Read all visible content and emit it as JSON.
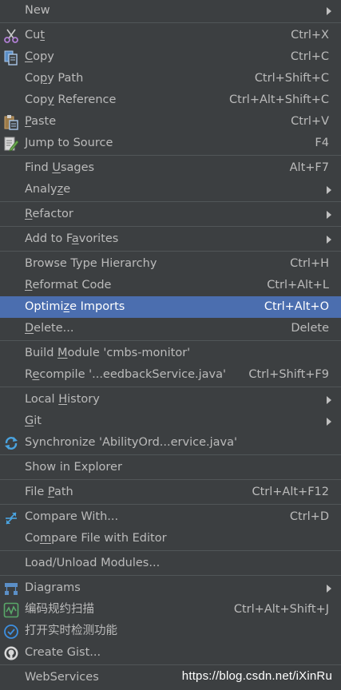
{
  "menu": {
    "new": {
      "label": "New"
    },
    "cut": {
      "pre": "Cu",
      "mn": "t",
      "post": "",
      "shortcut": "Ctrl+X"
    },
    "copy": {
      "pre": "",
      "mn": "C",
      "post": "opy",
      "shortcut": "Ctrl+C"
    },
    "copy_path": {
      "pre": "Co",
      "mn": "p",
      "post": "y Path",
      "shortcut": "Ctrl+Shift+C"
    },
    "copy_reference": {
      "pre": "Cop",
      "mn": "y",
      "post": " Reference",
      "shortcut": "Ctrl+Alt+Shift+C"
    },
    "paste": {
      "pre": "",
      "mn": "P",
      "post": "aste",
      "shortcut": "Ctrl+V"
    },
    "jump_to_source": {
      "label": "Jump to Source",
      "shortcut": "F4"
    },
    "find_usages": {
      "pre": "Find ",
      "mn": "U",
      "post": "sages",
      "shortcut": "Alt+F7"
    },
    "analyze": {
      "pre": "Analy",
      "mn": "z",
      "post": "e"
    },
    "refactor": {
      "pre": "",
      "mn": "R",
      "post": "efactor"
    },
    "add_to_favorites": {
      "pre": "Add to F",
      "mn": "a",
      "post": "vorites"
    },
    "browse_type_hierarchy": {
      "label": "Browse Type Hierarchy",
      "shortcut": "Ctrl+H"
    },
    "reformat_code": {
      "pre": "",
      "mn": "R",
      "post": "eformat Code",
      "shortcut": "Ctrl+Alt+L"
    },
    "optimize_imports": {
      "pre": "Optimi",
      "mn": "z",
      "post": "e Imports",
      "shortcut": "Ctrl+Alt+O"
    },
    "delete": {
      "pre": "",
      "mn": "D",
      "post": "elete...",
      "shortcut": "Delete"
    },
    "build_module": {
      "pre": "Build ",
      "mn": "M",
      "post": "odule 'cmbs-monitor'"
    },
    "recompile": {
      "pre": "R",
      "mn": "e",
      "post": "compile '...eedbackService.java'",
      "shortcut": "Ctrl+Shift+F9"
    },
    "local_history": {
      "pre": "Local ",
      "mn": "H",
      "post": "istory"
    },
    "git": {
      "pre": "",
      "mn": "G",
      "post": "it"
    },
    "synchronize": {
      "label": "Synchronize 'AbilityOrd...ervice.java'"
    },
    "show_in_explorer": {
      "label": "Show in Explorer"
    },
    "file_path": {
      "pre": "File ",
      "mn": "P",
      "post": "ath",
      "shortcut": "Ctrl+Alt+F12"
    },
    "compare_with": {
      "label": "Compare With...",
      "shortcut": "Ctrl+D"
    },
    "compare_file_with_editor": {
      "pre": "Co",
      "mn": "m",
      "post": "pare File with Editor"
    },
    "load_unload_modules": {
      "label": "Load/Unload Modules..."
    },
    "diagrams": {
      "label": "Diagrams"
    },
    "code_scan": {
      "label": "编码规约扫描",
      "shortcut": "Ctrl+Alt+Shift+J"
    },
    "realtime_check": {
      "label": "打开实时检测功能"
    },
    "create_gist": {
      "label": "Create Gist..."
    },
    "webservices": {
      "label": "WebServices"
    }
  },
  "watermark": "https://blog.csdn.net/iXinRu",
  "colors": {
    "background": "#3c3f41",
    "selection": "#4b6eaf",
    "separator": "#515658",
    "text": "#bbbbbb"
  }
}
